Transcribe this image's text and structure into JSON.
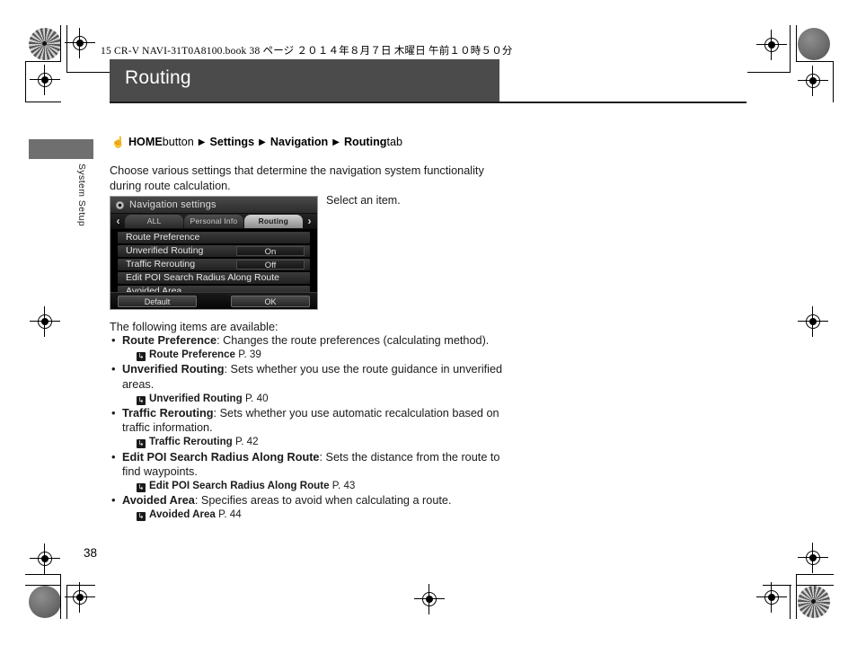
{
  "print_header": {
    "text": "15 CR-V NAVI-31T0A8100.book   38 ページ   ２０１４年８月７日   木曜日   午前１０時５０分"
  },
  "chapter": {
    "title": "Routing",
    "side_tab_label": "System Setup",
    "page_number": "38"
  },
  "breadcrumb": {
    "hand_icon": "hand-pointer-icon",
    "segments": [
      {
        "strong": "HOME",
        "plain": " button"
      },
      {
        "strong": "Settings",
        "plain": ""
      },
      {
        "strong": "Navigation",
        "plain": ""
      },
      {
        "strong": "Routing",
        "plain": " tab"
      }
    ],
    "arrow_glyph": "▶"
  },
  "intro": {
    "text": "Choose various settings that determine the navigation system functionality during route calculation."
  },
  "caption": {
    "select_an_item": "Select an item."
  },
  "device_screen": {
    "title": "Navigation settings",
    "gear_icon": "gear-icon",
    "left_arrow": "‹",
    "right_arrow": "›",
    "tabs": [
      {
        "label": "ALL",
        "active": false
      },
      {
        "label": "Personal Info",
        "active": false
      },
      {
        "label": "Routing",
        "active": true
      }
    ],
    "rows": [
      {
        "label": "Route Preference",
        "value": null
      },
      {
        "label": "Unverified Routing",
        "value": "On"
      },
      {
        "label": "Traffic Rerouting",
        "value": "Off"
      },
      {
        "label": "Edit POI Search Radius Along Route",
        "value": null
      },
      {
        "label": "Avoided Area",
        "value": null
      }
    ],
    "footer": {
      "default_label": "Default",
      "ok_label": "OK"
    }
  },
  "items_section": {
    "intro": "The following items are available:",
    "bullets": [
      {
        "term": "Route Preference",
        "desc": ": Changes the route preferences (calculating method).",
        "xref_icon": "↳",
        "xref_name": "Route Preference",
        "xref_page": "P. 39"
      },
      {
        "term": "Unverified Routing",
        "desc": ": Sets whether you use the route guidance in unverified areas.",
        "xref_icon": "↳",
        "xref_name": "Unverified Routing",
        "xref_page": "P. 40"
      },
      {
        "term": "Traffic Rerouting",
        "desc": ": Sets whether you use automatic recalculation based on traffic information.",
        "xref_icon": "↳",
        "xref_name": "Traffic Rerouting",
        "xref_page": "P. 42"
      },
      {
        "term": "Edit POI Search Radius Along Route",
        "desc": ": Sets the distance from the route to find waypoints.",
        "xref_icon": "↳",
        "xref_name": "Edit POI Search Radius Along Route",
        "xref_page": "P. 43"
      },
      {
        "term": "Avoided Area",
        "desc": ": Specifies areas to avoid when calculating a route.",
        "xref_icon": "↳",
        "xref_name": "Avoided Area",
        "xref_page": "P. 44"
      }
    ]
  },
  "colors": {
    "title_bar": "#4b4b4b",
    "side_tab": "#6f6f6f",
    "text": "#1a1a1a",
    "device_bg": "#000000"
  }
}
